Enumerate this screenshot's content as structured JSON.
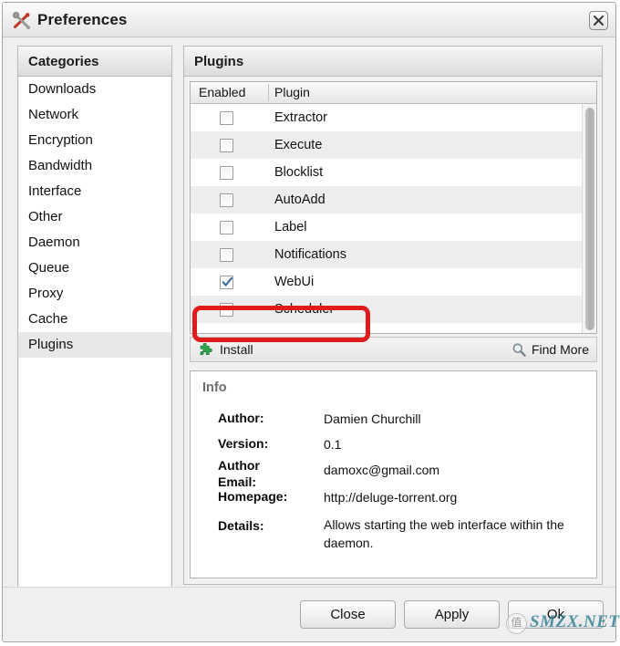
{
  "window": {
    "title": "Preferences",
    "icon": "tools-icon",
    "close_label": "✕"
  },
  "categories": {
    "header": "Categories",
    "selected": "Plugins",
    "items": [
      "Downloads",
      "Network",
      "Encryption",
      "Bandwidth",
      "Interface",
      "Other",
      "Daemon",
      "Queue",
      "Proxy",
      "Cache",
      "Plugins"
    ]
  },
  "plugins_panel": {
    "header": "Plugins",
    "columns": [
      "Enabled",
      "Plugin"
    ],
    "rows": [
      {
        "name": "Extractor",
        "enabled": false
      },
      {
        "name": "Execute",
        "enabled": false
      },
      {
        "name": "Blocklist",
        "enabled": false
      },
      {
        "name": "AutoAdd",
        "enabled": false
      },
      {
        "name": "Label",
        "enabled": false
      },
      {
        "name": "Notifications",
        "enabled": false
      },
      {
        "name": "WebUi",
        "enabled": true
      },
      {
        "name": "Scheduler",
        "enabled": false
      }
    ],
    "install_label": "Install",
    "install_icon": "puzzle-piece-icon",
    "find_more_label": "Find More",
    "find_more_icon": "magnifier-icon"
  },
  "info": {
    "title": "Info",
    "fields": [
      {
        "label": "Author:",
        "value": "Damien Churchill"
      },
      {
        "label": "Version:",
        "value": "0.1"
      },
      {
        "label": "Author Email:",
        "value": "damoxc@gmail.com"
      },
      {
        "label": "Homepage:",
        "value": "http://deluge-torrent.org"
      },
      {
        "label": "Details:",
        "value": "Allows starting the web interface within the daemon."
      }
    ]
  },
  "footer": {
    "close": "Close",
    "apply": "Apply",
    "ok": "Ok"
  },
  "watermark": {
    "text": "SMZX.NET",
    "badge": "值"
  },
  "colors": {
    "annotation": "#e01b1b",
    "checkmark": "#3b6ea5",
    "install_icon": "#2fa44f",
    "watermark": "#2e7f94"
  }
}
